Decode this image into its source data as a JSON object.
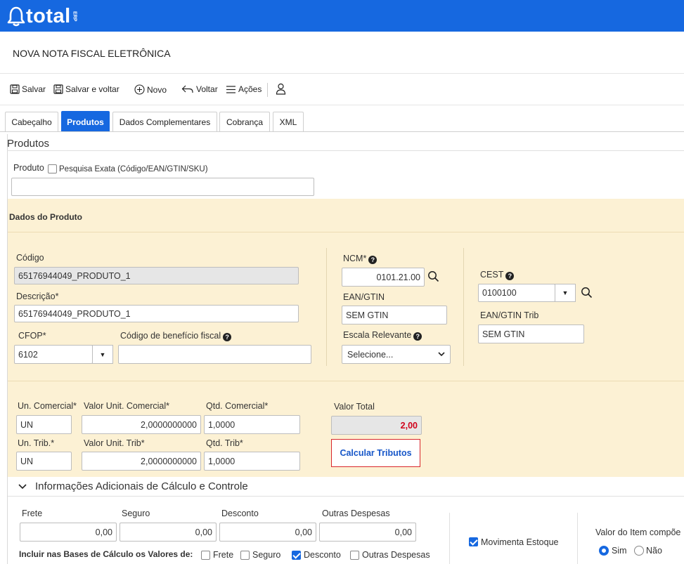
{
  "brand": {
    "name": "total",
    "suffix": "ERP",
    "color": "#1668e0"
  },
  "page": {
    "title": "NOVA NOTA FISCAL ELETRÔNICA"
  },
  "toolbar": {
    "save": "Salvar",
    "save_back": "Salvar e voltar",
    "new": "Novo",
    "back": "Voltar",
    "actions": "Ações"
  },
  "tabs": [
    {
      "label": "Cabeçalho"
    },
    {
      "label": "Produtos"
    },
    {
      "label": "Dados Complementares"
    },
    {
      "label": "Cobrança"
    },
    {
      "label": "XML"
    }
  ],
  "produtos": {
    "section_title": "Produtos",
    "produto_label": "Produto",
    "exact_search_label": "Pesquisa Exata (Código/EAN/GTIN/SKU)",
    "produto_value": ""
  },
  "dados": {
    "title": "Dados do Produto",
    "codigo_label": "Código",
    "codigo_value": "65176944049_PRODUTO_1",
    "descricao_label": "Descrição*",
    "descricao_value": "65176944049_PRODUTO_1",
    "cfop_label": "CFOP*",
    "cfop_value": "6102",
    "beneficio_label": "Código de benefício fiscal",
    "beneficio_value": "",
    "ncm_label": "NCM*",
    "ncm_value": "0101.21.00",
    "ean_label": "EAN/GTIN",
    "ean_value": "SEM GTIN",
    "escala_label": "Escala Relevante",
    "escala_value": "Selecione...",
    "cest_label": "CEST",
    "cest_value": "0100100",
    "ean_trib_label": "EAN/GTIN Trib",
    "ean_trib_value": "SEM GTIN"
  },
  "valores": {
    "un_com_label": "Un. Comercial*",
    "un_com_value": "UN",
    "vu_com_label": "Valor Unit. Comercial*",
    "vu_com_value": "2,0000000000",
    "qtd_com_label": "Qtd. Comercial*",
    "qtd_com_value": "1,0000",
    "un_trib_label": "Un. Trib.*",
    "un_trib_value": "UN",
    "vu_trib_label": "Valor Unit. Trib*",
    "vu_trib_value": "2,0000000000",
    "qtd_trib_label": "Qtd. Trib*",
    "qtd_trib_value": "1,0000",
    "total_label": "Valor Total",
    "total_value": "2,00",
    "calc_button": "Calcular Tributos"
  },
  "info": {
    "title": "Informações Adicionais de Cálculo e Controle",
    "frete_label": "Frete",
    "frete_value": "0,00",
    "seguro_label": "Seguro",
    "seguro_value": "0,00",
    "desconto_label": "Desconto",
    "desconto_value": "0,00",
    "outras_label": "Outras Despesas",
    "outras_value": "0,00",
    "bases_label": "Incluir nas Bases de Cálculo os Valores de:",
    "chk_frete": "Frete",
    "chk_seguro": "Seguro",
    "chk_desconto": "Desconto",
    "chk_outras": "Outras Despesas",
    "movimenta_label": "Movimenta Estoque",
    "valor_item_label": "Valor do Item compõe",
    "sim": "Sim",
    "nao": "Não"
  }
}
